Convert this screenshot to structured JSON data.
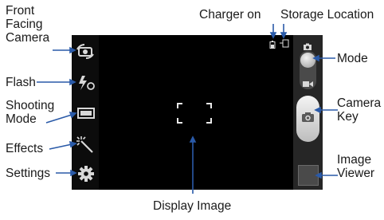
{
  "labels": {
    "front_facing_camera": "Front\nFacing\nCamera",
    "flash": "Flash",
    "shooting_mode": "Shooting\nMode",
    "effects": "Effects",
    "settings": "Settings",
    "charger_on": "Charger on",
    "storage_location": "Storage Location",
    "mode": "Mode",
    "camera_key": "Camera\nKey",
    "image_viewer": "Image\nViewer",
    "display_image": "Display Image"
  },
  "icons": {
    "front_camera": "camera-switch-icon",
    "flash": "flash-auto-icon",
    "shooting_mode": "shooting-mode-icon",
    "effects": "effects-wand-icon",
    "settings": "gear-icon",
    "charger": "battery-charging-icon",
    "storage": "storage-card-icon",
    "mode_camera": "camera-mode-icon",
    "mode_video": "video-mode-icon",
    "camera_key": "camera-shutter-icon",
    "focus": "focus-frame-icon"
  },
  "colors": {
    "screen": "#000000",
    "pointer": "#2a5aa8",
    "label_text": "#1a1a1a"
  }
}
